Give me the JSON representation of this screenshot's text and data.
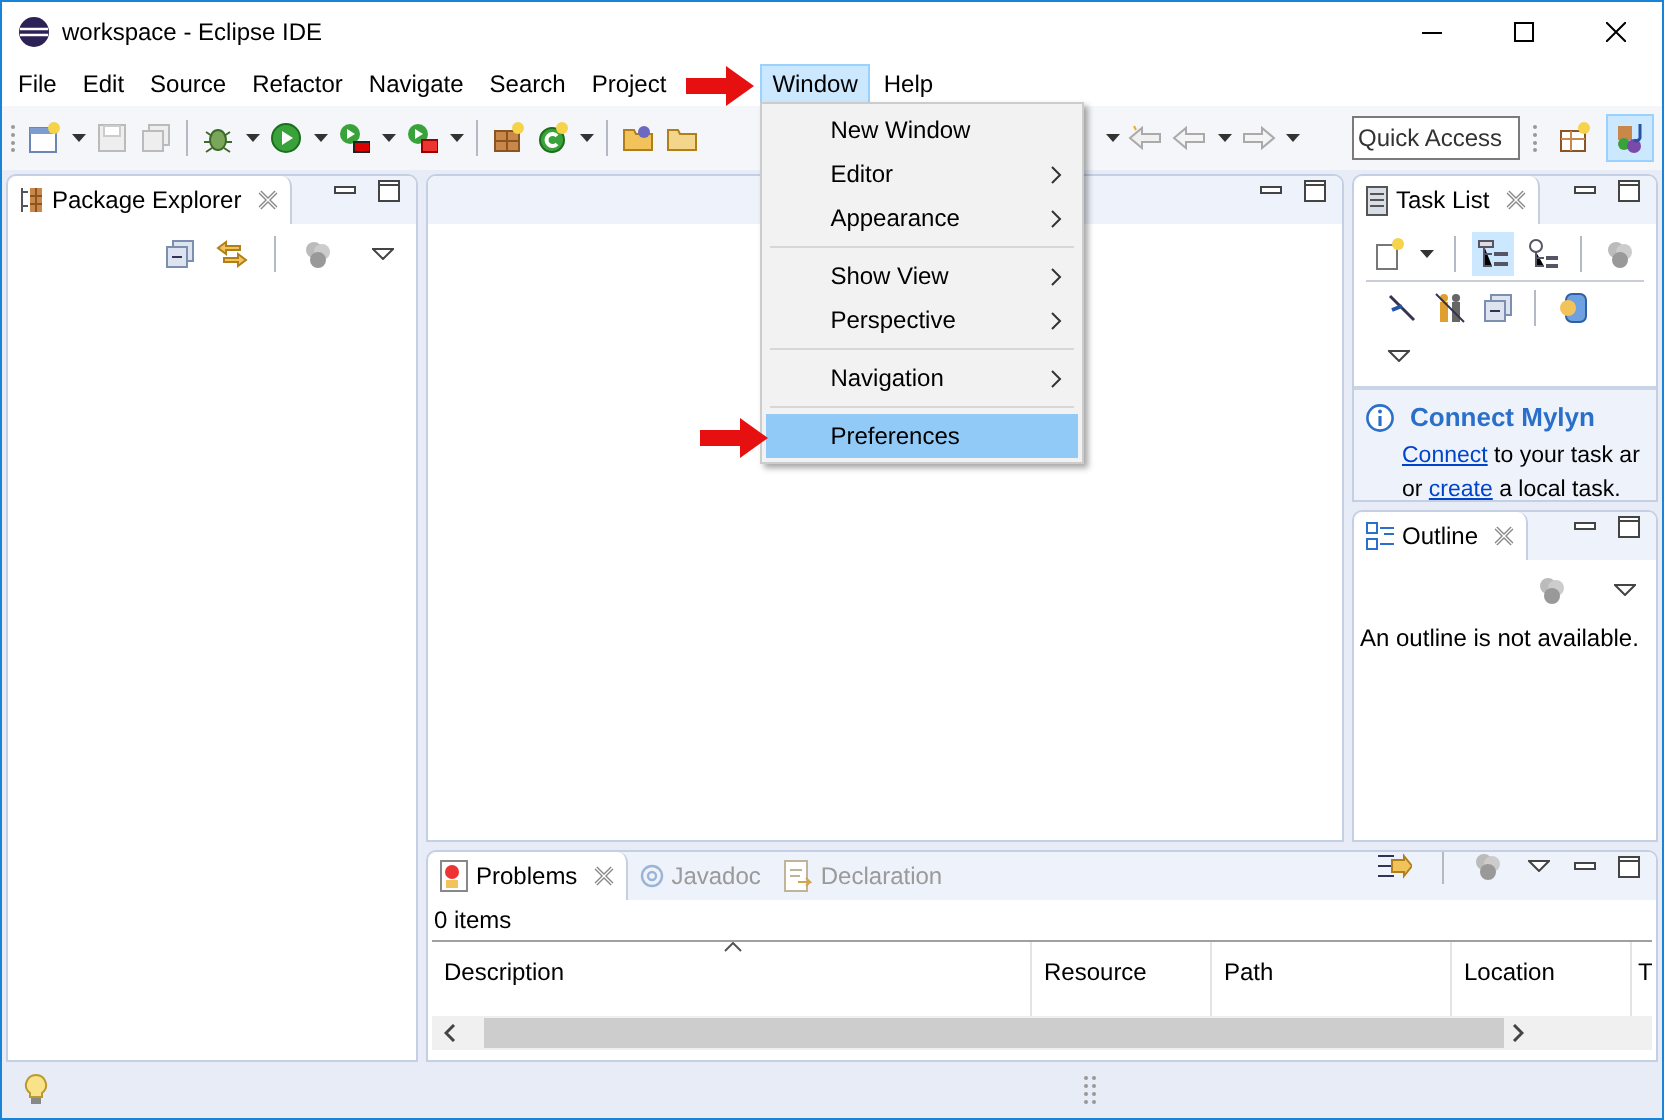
{
  "window": {
    "title": "workspace - Eclipse IDE"
  },
  "menu_bar": [
    {
      "label": "File",
      "selected": false
    },
    {
      "label": "Edit",
      "selected": false
    },
    {
      "label": "Source",
      "selected": false
    },
    {
      "label": "Refactor",
      "selected": false
    },
    {
      "label": "Navigate",
      "selected": false
    },
    {
      "label": "Search",
      "selected": false
    },
    {
      "label": "Project",
      "selected": false
    },
    {
      "label": "Window",
      "selected": true
    },
    {
      "label": "Help",
      "selected": false
    }
  ],
  "toolbar": {
    "quick_access": {
      "placeholder": "Quick Access"
    },
    "perspectives": [
      {
        "kind": "open",
        "selected": false
      },
      {
        "kind": "java",
        "selected": true
      }
    ]
  },
  "package_explorer": {
    "tab": {
      "label": "Package Explorer",
      "selected": true
    }
  },
  "task_list": {
    "tab": {
      "label": "Task List",
      "selected": true
    },
    "mylyn": {
      "title": "Connect Mylyn",
      "lines": [
        [
          {
            "text": "Connect",
            "link": true
          },
          {
            "text": " to your task ar",
            "link": false
          }
        ],
        [
          {
            "text": "or ",
            "link": false
          },
          {
            "text": "create",
            "link": true
          },
          {
            "text": " a local task.",
            "link": false
          }
        ]
      ]
    }
  },
  "outline": {
    "tab": {
      "label": "Outline",
      "selected": true
    },
    "message": "An outline is not available."
  },
  "bottom_panel": {
    "tabs": [
      {
        "kind": "problems",
        "label": "Problems",
        "selected": true
      },
      {
        "kind": "javadoc",
        "label": "Javadoc",
        "selected": false
      },
      {
        "kind": "declaration",
        "label": "Declaration",
        "selected": false
      }
    ],
    "summary": "0 items",
    "table": {
      "columns": [
        {
          "label": "Description",
          "sorted": true
        },
        {
          "label": "Resource",
          "sorted": false
        },
        {
          "label": "Path",
          "sorted": false
        },
        {
          "label": "Location",
          "sorted": false
        },
        {
          "label": "T",
          "sorted": false
        }
      ]
    }
  },
  "window_menu": {
    "items": [
      {
        "kind": "item",
        "label": "New Window",
        "submenu": false,
        "selected": false
      },
      {
        "kind": "item",
        "label": "Editor",
        "submenu": true,
        "selected": false
      },
      {
        "kind": "item",
        "label": "Appearance",
        "submenu": true,
        "selected": false
      },
      {
        "kind": "separator"
      },
      {
        "kind": "item",
        "label": "Show View",
        "submenu": true,
        "selected": false
      },
      {
        "kind": "item",
        "label": "Perspective",
        "submenu": true,
        "selected": false
      },
      {
        "kind": "separator"
      },
      {
        "kind": "item",
        "label": "Navigation",
        "submenu": true,
        "selected": false
      },
      {
        "kind": "separator"
      },
      {
        "kind": "item",
        "label": "Preferences",
        "submenu": false,
        "selected": true
      }
    ]
  }
}
